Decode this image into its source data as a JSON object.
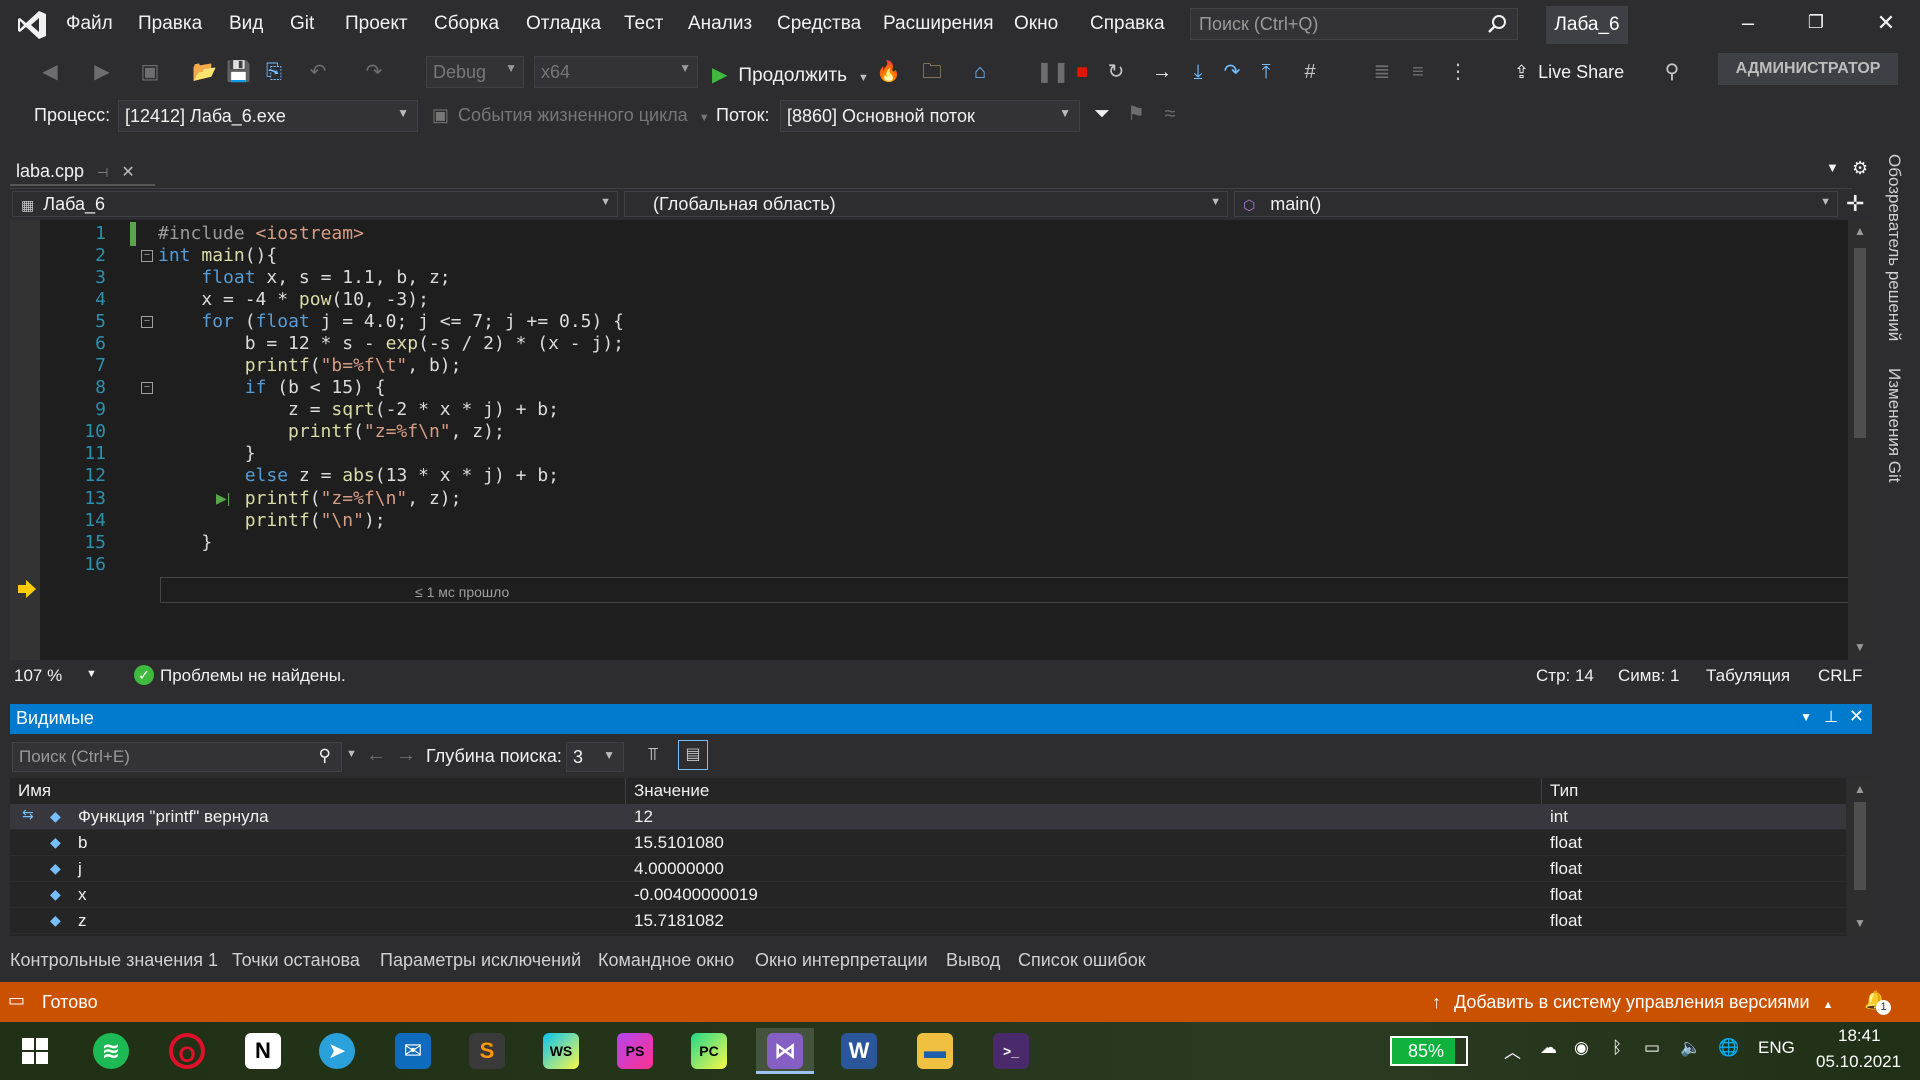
{
  "menu": [
    "Файл",
    "Правка",
    "Вид",
    "Git",
    "Проект",
    "Сборка",
    "Отладка",
    "Тест",
    "Анализ",
    "Средства",
    "Расширения",
    "Окно",
    "Справка"
  ],
  "search": {
    "placeholder": "Поиск (Ctrl+Q)"
  },
  "solution_name": "Лаба_6",
  "toolbar": {
    "config": "Debug",
    "platform": "x64",
    "continue_label": "Продолжить",
    "live_share": "Live Share",
    "admin": "АДМИНИСТРАТОР"
  },
  "debug_location": {
    "process_label": "Процесс:",
    "process_value": "[12412] Лаба_6.exe",
    "lifecycle_label": "События жизненного цикла",
    "thread_label": "Поток:",
    "thread_value": "[8860] Основной поток"
  },
  "editor": {
    "tab_label": "laba.cpp",
    "project_combo": "Лаба_6",
    "scope_combo": "(Глобальная область)",
    "member_combo": "main()",
    "line_numbers": [
      "1",
      "2",
      "3",
      "4",
      "5",
      "6",
      "7",
      "8",
      "9",
      "10",
      "11",
      "12",
      "13",
      "14",
      "15",
      "16"
    ],
    "current_line": 14,
    "perf_hint": "≤ 1 мс прошло",
    "code": [
      "#include <iostream>",
      "int main(){",
      "    float x, s = 1.1, b, z;",
      "    x = -4 * pow(10, -3);",
      "    for (float j = 4.0; j <= 7; j += 0.5) {",
      "        b = 12 * s - exp(-s / 2) * (x - j);",
      "        printf(\"b=%f\\t\", b);",
      "        if (b < 15) {",
      "            z = sqrt(-2 * x * j) + b;",
      "            printf(\"z=%f\\n\", z);",
      "        }",
      "        else z = abs(13 * x * j) + b;",
      "        printf(\"z=%f\\n\", z);",
      "        printf(\"\\n\");",
      "    }",
      ""
    ]
  },
  "editor_status": {
    "zoom": "107 %",
    "issues": "Проблемы не найдены.",
    "line": "Стр: 14",
    "col": "Симв: 1",
    "indent": "Табуляция",
    "eol": "CRLF"
  },
  "side_panels": [
    "Обозреватель решений",
    "Изменения Git"
  ],
  "autos": {
    "title": "Видимые",
    "search_placeholder": "Поиск (Ctrl+E)",
    "depth_label": "Глубина поиска:",
    "depth_value": "3",
    "columns": [
      "Имя",
      "Значение",
      "Тип"
    ],
    "rows": [
      {
        "name": "Функция \"printf\" вернула",
        "value": "12",
        "type": "int"
      },
      {
        "name": "b",
        "value": "15.5101080",
        "type": "float"
      },
      {
        "name": "j",
        "value": "4.00000000",
        "type": "float"
      },
      {
        "name": "x",
        "value": "-0.00400000019",
        "type": "float"
      },
      {
        "name": "z",
        "value": "15.7181082",
        "type": "float"
      }
    ]
  },
  "tool_tabs": [
    "Контрольные значения 1",
    "Точки останова",
    "Параметры исключений",
    "Командное окно",
    "Окно интерпретации",
    "Вывод",
    "Список ошибок"
  ],
  "statusbar": {
    "ready": "Готово",
    "vcs": "Добавить в систему управления версиями",
    "notifications": "1"
  },
  "taskbar": {
    "battery": "85%",
    "lang": "ENG",
    "time": "18:41",
    "date": "05.10.2021"
  },
  "colors": {
    "accent": "#007acc",
    "statusbar": "#ca5100",
    "editor_bg": "#1e1e1e"
  }
}
